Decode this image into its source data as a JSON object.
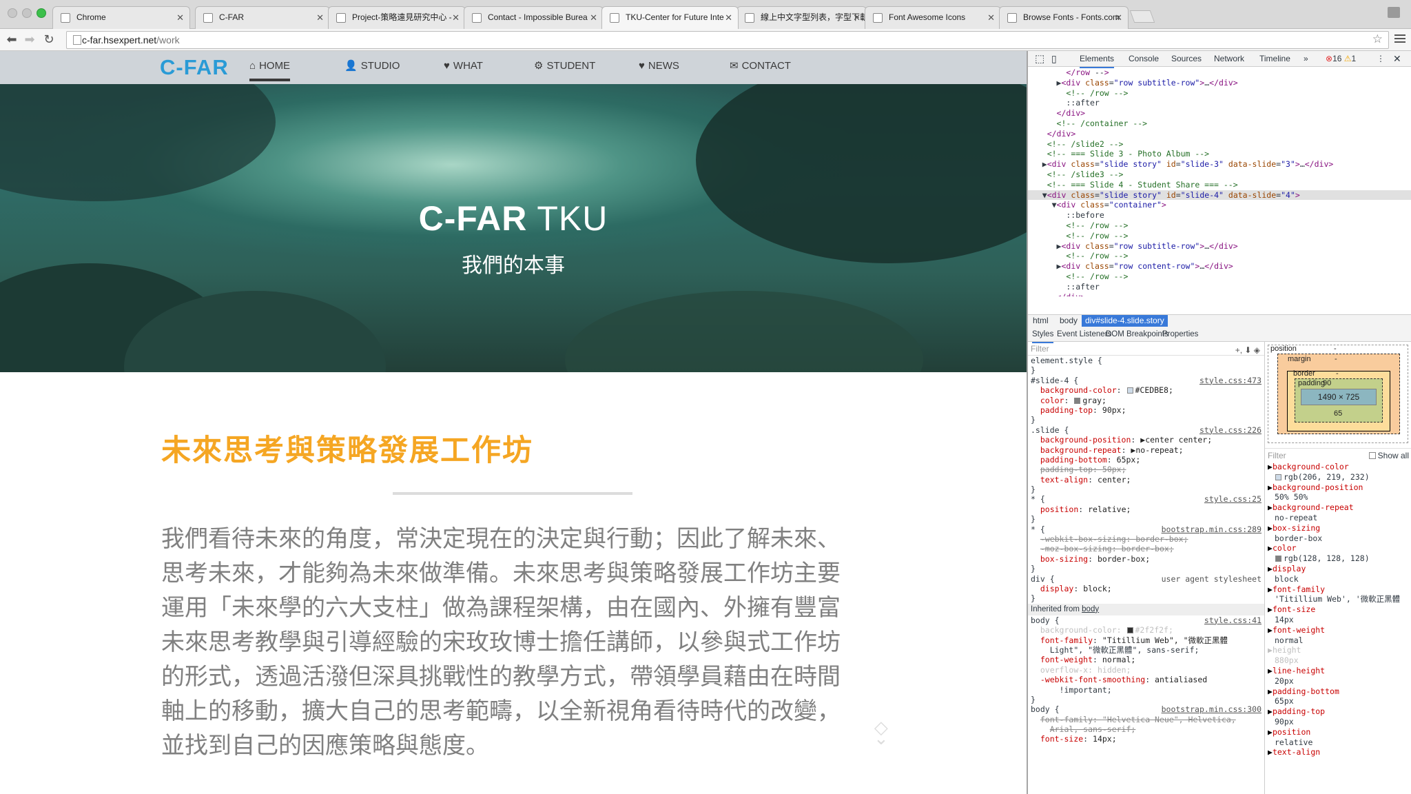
{
  "browser": {
    "tabs": [
      {
        "label": "Chrome",
        "active": false
      },
      {
        "label": "C-FAR",
        "active": false
      },
      {
        "label": "Project-策略遠見研究中心 -",
        "active": false
      },
      {
        "label": "Contact - Impossible Burea",
        "active": false
      },
      {
        "label": "TKU-Center for Future Inte",
        "active": true
      },
      {
        "label": "線上中文字型列表，字型下載",
        "active": false
      },
      {
        "label": "Font Awesome Icons",
        "active": false
      },
      {
        "label": "Browse Fonts - Fonts.com",
        "active": false
      }
    ],
    "close_glyph": "✕",
    "url_host": "c-far.hsexpert.net",
    "url_path": "/work"
  },
  "site": {
    "logo": "C-FAR",
    "nav": [
      {
        "label": "HOME",
        "icon": "home-icon",
        "glyph": "⌂",
        "active": true
      },
      {
        "label": "STUDIO",
        "icon": "user-icon",
        "glyph": "👤",
        "active": false
      },
      {
        "label": "WHAT",
        "icon": "heart-icon",
        "glyph": "♥",
        "active": false
      },
      {
        "label": "STUDENT",
        "icon": "gears-icon",
        "glyph": "⚙",
        "active": false
      },
      {
        "label": "NEWS",
        "icon": "heart-icon",
        "glyph": "♥",
        "active": false
      },
      {
        "label": "CONTACT",
        "icon": "envelope-icon",
        "glyph": "✉",
        "active": false
      }
    ],
    "hero": {
      "title_bold": "C-FAR",
      "title_thin": " TKU",
      "subtitle": "我們的本事"
    },
    "heading": "未來思考與策略發展工作坊",
    "paragraph": "我們看待未來的角度，常決定現在的決定與行動；因此了解未來、思考未來，才能夠為未來做準備。未來思考與策略發展工作坊主要運用「未來學的六大支柱」做為課程架構，由在國內、外擁有豐富未來思考教學與引導經驗的宋玫玫博士擔任講師，以參與式工作坊的形式，透過活潑但深具挑戰性的教學方式，帶領學員藉由在時間軸上的移動，擴大自己的思考範疇，以全新視角看待時代的改變，並找到自己的因應策略與態度。",
    "scroll_glyph": "◇"
  },
  "devtools": {
    "tabs": [
      "Elements",
      "Console",
      "Sources",
      "Network",
      "Timeline"
    ],
    "active_tab": "Elements",
    "overflow": "»",
    "errors": "16",
    "warnings": "1",
    "dom_lines": [
      {
        "text": "        </row -->",
        "sel": false
      },
      {
        "text": "      ▶<div class=\"row subtitle-row\">…</div>",
        "sel": false
      },
      {
        "text": "        <!-- /row -->",
        "sel": false
      },
      {
        "text": "        ::after",
        "sel": false
      },
      {
        "text": "      </div>",
        "sel": false
      },
      {
        "text": "      <!-- /container -->",
        "sel": false
      },
      {
        "text": "    </div>",
        "sel": false
      },
      {
        "text": "    <!-- /slide2 -->",
        "sel": false
      },
      {
        "text": "    <!-- === Slide 3 - Photo Album -->",
        "sel": false
      },
      {
        "text": "   ▶<div class=\"slide story\" id=\"slide-3\" data-slide=\"3\">…</div>",
        "sel": false
      },
      {
        "text": "    <!-- /slide3 -->",
        "sel": false
      },
      {
        "text": "    <!-- === Slide 4 - Student Share === -->",
        "sel": false
      },
      {
        "text": "   ▼<div class=\"slide story\" id=\"slide-4\" data-slide=\"4\">",
        "sel": true
      },
      {
        "text": "     ▼<div class=\"container\">",
        "sel": false
      },
      {
        "text": "        ::before",
        "sel": false
      },
      {
        "text": "        <!-- /row -->",
        "sel": false
      },
      {
        "text": "        <!-- /row -->",
        "sel": false
      },
      {
        "text": "      ▶<div class=\"row subtitle-row\">…</div>",
        "sel": false
      },
      {
        "text": "        <!-- /row -->",
        "sel": false
      },
      {
        "text": "      ▶<div class=\"row content-row\">…</div>",
        "sel": false
      },
      {
        "text": "        <!-- /row -->",
        "sel": false
      },
      {
        "text": "        ::after",
        "sel": false
      },
      {
        "text": "      </div>",
        "sel": false
      },
      {
        "text": "      <!-- /container -->",
        "sel": false
      }
    ],
    "breadcrumbs": [
      {
        "label": "html",
        "sel": false
      },
      {
        "label": "body",
        "sel": false
      },
      {
        "label": "div#slide-4.slide.story",
        "sel": true
      }
    ],
    "subtabs": [
      "Styles",
      "Event Listeners",
      "DOM Breakpoints",
      "Properties"
    ],
    "styles_filter": "Filter",
    "filter_icons": "+, ⬇ ◈",
    "style_rules": [
      {
        "sel": "element.style {",
        "src": ""
      },
      {
        "sel": "}",
        "src": ""
      },
      {
        "sel": "#slide-4 {",
        "src": "style.css:473"
      },
      {
        "prop": "background-color",
        "val": "#CEDBE8;",
        "swatch": "#CEDBE8"
      },
      {
        "prop": "color",
        "val": "gray;",
        "swatch": "#808080"
      },
      {
        "prop": "padding-top",
        "val": "90px;"
      },
      {
        "sel": "}",
        "src": ""
      },
      {
        "sel": ".slide {",
        "src": "style.css:226"
      },
      {
        "prop": "background-position",
        "val": "▶center center;"
      },
      {
        "prop": "background-repeat",
        "val": "▶no-repeat;"
      },
      {
        "prop": "padding-bottom",
        "val": "65px;"
      },
      {
        "prop": "padding-top",
        "val": "50px;",
        "strike": true
      },
      {
        "prop": "text-align",
        "val": "center;"
      },
      {
        "sel": "}",
        "src": ""
      },
      {
        "sel": "* {",
        "src": "style.css:25"
      },
      {
        "prop": "position",
        "val": "relative;"
      },
      {
        "sel": "}",
        "src": ""
      },
      {
        "sel": "* {",
        "src": "bootstrap.min.css:289"
      },
      {
        "prop": "-webkit-box-sizing",
        "val": "border-box;",
        "strike": true
      },
      {
        "prop": "-moz-box-sizing",
        "val": "border-box;",
        "strike": true
      },
      {
        "prop": "box-sizing",
        "val": "border-box;"
      },
      {
        "sel": "}",
        "src": ""
      },
      {
        "sel": "div {",
        "src": "user agent stylesheet",
        "ua": true
      },
      {
        "prop": "display",
        "val": "block;"
      },
      {
        "sel": "}",
        "src": ""
      },
      {
        "inherited": "Inherited from ",
        "inherited_link": "body"
      },
      {
        "sel": "body {",
        "src": "style.css:41"
      },
      {
        "prop": "background-color",
        "val": "#2f2f2f;",
        "swatch": "#2f2f2f",
        "dim": true
      },
      {
        "prop": "font-family",
        "val": "\"Titillium Web\", \"微軟正黑體"
      },
      {
        "cont": "Light\", \"微軟正黑體\", sans-serif;"
      },
      {
        "prop": "font-weight",
        "val": "normal;"
      },
      {
        "prop": "overflow-x",
        "val": "hidden;",
        "dim": true
      },
      {
        "prop": "-webkit-font-smoothing",
        "val": "antialiased"
      },
      {
        "cont": "  !important;"
      },
      {
        "sel": "}",
        "src": ""
      },
      {
        "sel": "body {",
        "src": "bootstrap.min.css:300"
      },
      {
        "prop": "font-family",
        "val": "\"Helvetica Neue\", Helvetica,",
        "strike": true
      },
      {
        "cont": "Arial, sans-serif;",
        "strike": true
      },
      {
        "prop": "font-size",
        "val": "14px;"
      }
    ],
    "box_model": {
      "position_label": "position",
      "margin_label": "margin",
      "border_label": "border",
      "padding_label": "padding",
      "padding_top": "90",
      "content": "1490 × 725",
      "padding_bottom": "65",
      "dash": "-"
    },
    "computed_filter": "Filter",
    "show_all": "Show all",
    "computed": [
      {
        "name": "background-color",
        "value": "rgb(206, 219, 232)",
        "swatch": "#CEDBE8"
      },
      {
        "name": "background-position",
        "value": "50% 50%"
      },
      {
        "name": "background-repeat",
        "value": "no-repeat"
      },
      {
        "name": "box-sizing",
        "value": "border-box"
      },
      {
        "name": "color",
        "value": "rgb(128, 128, 128)",
        "swatch": "#808080"
      },
      {
        "name": "display",
        "value": "block"
      },
      {
        "name": "font-family",
        "value": "'Titillium Web', '微軟正黑體"
      },
      {
        "name": "font-size",
        "value": "14px"
      },
      {
        "name": "font-weight",
        "value": "normal"
      },
      {
        "name": "height",
        "value": "880px",
        "dim": true
      },
      {
        "name": "line-height",
        "value": "20px"
      },
      {
        "name": "padding-bottom",
        "value": "65px"
      },
      {
        "name": "padding-top",
        "value": "90px"
      },
      {
        "name": "position",
        "value": "relative"
      },
      {
        "name": "text-align",
        "value": ""
      }
    ]
  }
}
